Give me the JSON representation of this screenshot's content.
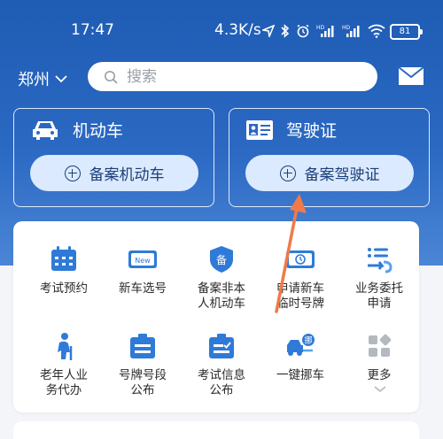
{
  "status_bar": {
    "time": "17:47",
    "net_speed": "4.3K/s",
    "battery": "81",
    "icons": [
      "location-arrow-icon",
      "bluetooth-icon",
      "alarm-icon",
      "signal-hd-icon",
      "signal-hd-icon",
      "wifi-icon",
      "battery-icon"
    ]
  },
  "header": {
    "city": "郑州",
    "search_placeholder": "搜索",
    "mail_icon": "mail-icon"
  },
  "cards": [
    {
      "title": "机动车",
      "icon": "car-icon",
      "button": "备案机动车"
    },
    {
      "title": "驾驶证",
      "icon": "id-card-icon",
      "button": "备案驾驶证"
    }
  ],
  "services": [
    {
      "label1": "考试预约",
      "label2": "",
      "icon": "calendar-icon"
    },
    {
      "label1": "新车选号",
      "label2": "",
      "icon": "new-plate-icon"
    },
    {
      "label1": "备案非本",
      "label2": "人机动车",
      "icon": "shield-icon"
    },
    {
      "label1": "申请新车",
      "label2": "临时号牌",
      "icon": "temp-plate-icon"
    },
    {
      "label1": "业务委托",
      "label2": "申请",
      "icon": "delegate-icon"
    },
    {
      "label1": "老年人业",
      "label2": "务代办",
      "icon": "elderly-icon"
    },
    {
      "label1": "号牌号段",
      "label2": "公布",
      "icon": "plate-segment-icon"
    },
    {
      "label1": "考试信息",
      "label2": "公布",
      "icon": "exam-info-icon"
    },
    {
      "label1": "一键挪车",
      "label2": "",
      "icon": "move-car-icon"
    },
    {
      "label1": "更多",
      "label2": "",
      "icon": "more-icon"
    }
  ],
  "colors": {
    "hero_blue": "#1f5cb4",
    "icon_blue": "#2f7ad8",
    "annotation_arrow": "#f07a48"
  }
}
